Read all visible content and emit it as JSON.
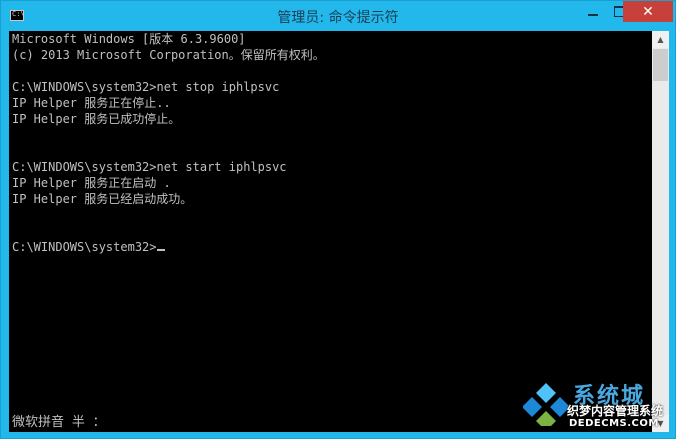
{
  "window": {
    "title": "管理员: 命令提示符",
    "icon_label": "C:\\",
    "minimize_icon": "minimize-icon",
    "maximize_icon": "maximize-icon",
    "close_label": "✕"
  },
  "console": {
    "lines": [
      "Microsoft Windows [版本 6.3.9600]",
      "(c) 2013 Microsoft Corporation。保留所有权利。",
      "",
      "C:\\WINDOWS\\system32>net stop iphlpsvc",
      "IP Helper 服务正在停止..",
      "IP Helper 服务已成功停止。",
      "",
      "",
      "C:\\WINDOWS\\system32>net start iphlpsvc",
      "IP Helper 服务正在启动 .",
      "IP Helper 服务已经启动成功。",
      "",
      "",
      "C:\\WINDOWS\\system32>"
    ],
    "ime_status": "微软拼音 半 ："
  },
  "watermark": {
    "name": "系统城",
    "subtitle": "织梦内容管理系统",
    "url": "DEDECMS.COM",
    "colors": {
      "blue": "#1e88d8",
      "sky": "#4fc3f7",
      "green": "#7cb342"
    }
  }
}
